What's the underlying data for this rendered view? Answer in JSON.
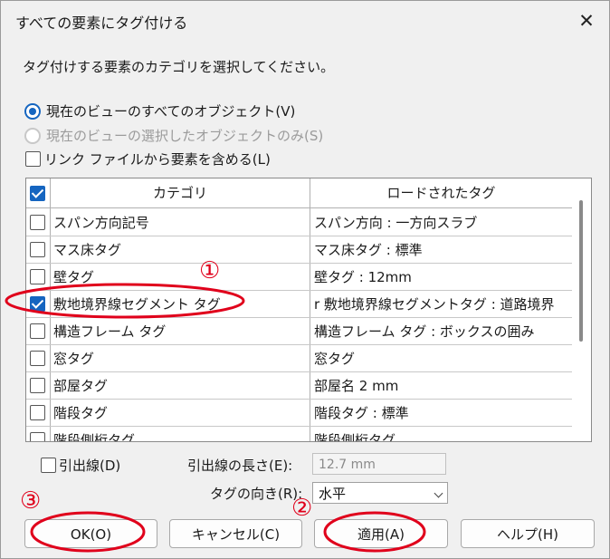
{
  "window": {
    "title": "すべての要素にタグ付ける",
    "close_glyph": "✕"
  },
  "instruction": "タグ付けする要素のカテゴリを選択してください。",
  "options": {
    "all_objects": "現在のビューのすべてのオブジェクト(V)",
    "selected_only": "現在のビューの選択したオブジェクトのみ(S)",
    "include_links": "リンク ファイルから要素を含める(L)"
  },
  "table": {
    "col_category": "カテゴリ",
    "col_loaded_tag": "ロードされたタグ",
    "rows": [
      {
        "category": "スパン方向記号",
        "tag": "スパン方向 : 一方向スラブ",
        "checked": false
      },
      {
        "category": "マス床タグ",
        "tag": "マス床タグ : 標準",
        "checked": false
      },
      {
        "category": "壁タグ",
        "tag": "壁タグ : 12mm",
        "checked": false
      },
      {
        "category": "敷地境界線セグメント タグ",
        "tag": "r 敷地境界線セグメントタグ : 道路境界",
        "checked": true
      },
      {
        "category": "構造フレーム タグ",
        "tag": "構造フレーム タグ : ボックスの囲み",
        "checked": false
      },
      {
        "category": "窓タグ",
        "tag": "窓タグ",
        "checked": false
      },
      {
        "category": "部屋タグ",
        "tag": "部屋名 2 mm",
        "checked": false
      },
      {
        "category": "階段タグ",
        "tag": "階段タグ : 標準",
        "checked": false
      },
      {
        "category": "階段側桁タグ",
        "tag": "階段側桁タグ",
        "checked": false
      }
    ]
  },
  "leader": {
    "label": "引出線(D)",
    "length_label": "引出線の長さ(E):",
    "length_value": "12.7 mm",
    "orientation_label": "タグの向き(R):",
    "orientation_value": "水平"
  },
  "buttons": {
    "ok": "OK(O)",
    "cancel": "キャンセル(C)",
    "apply": "適用(A)",
    "help": "ヘルプ(H)"
  },
  "annotations": {
    "step1": "①",
    "step2": "②",
    "step3": "③",
    "color": "#e0001b"
  },
  "colors": {
    "accent": "#1565c0"
  }
}
